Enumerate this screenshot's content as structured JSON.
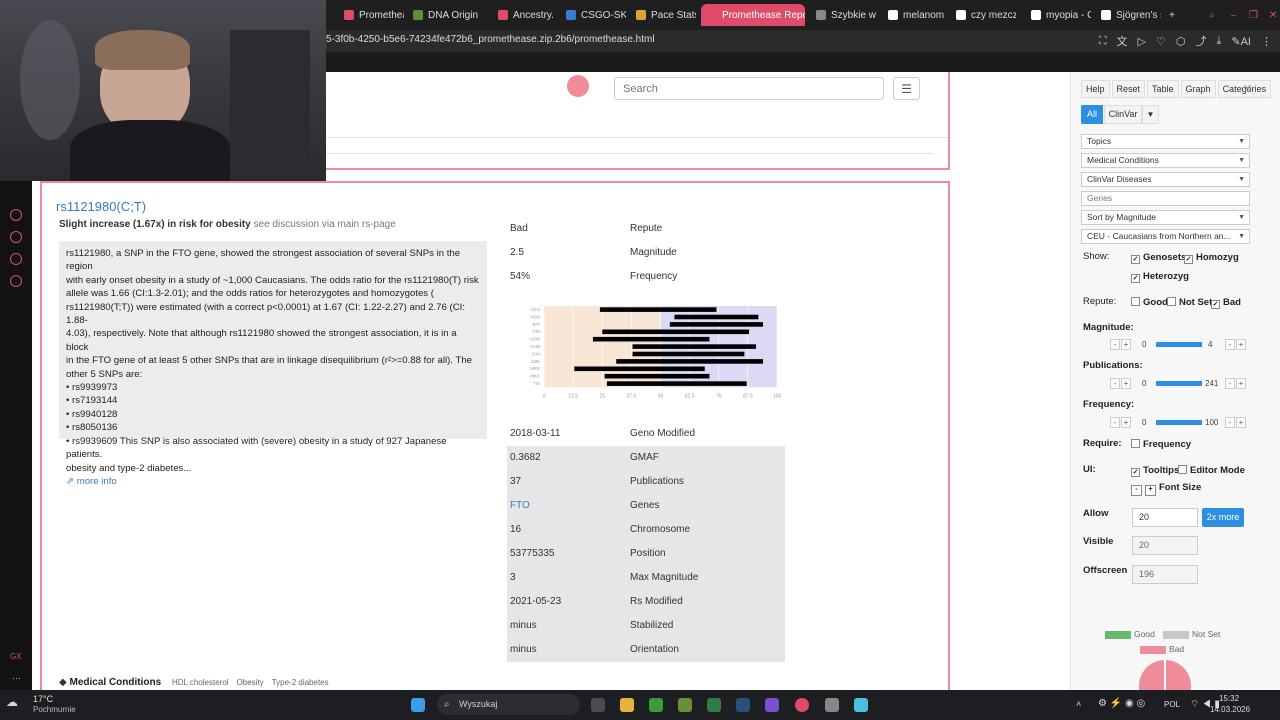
{
  "tabs": [
    {
      "label": "Promethea",
      "color": "#e14b6a",
      "active": false
    },
    {
      "label": "DNA Origin",
      "color": "#5a8f3c",
      "active": false
    },
    {
      "label": "Ancestry.c",
      "color": "#e14b6a",
      "active": false
    },
    {
      "label": "CSGO-SKII",
      "color": "#3a7bd5",
      "active": false
    },
    {
      "label": "Pace Stats",
      "color": "#d9a33a",
      "active": false
    },
    {
      "label": "Promethease Report",
      "color": "#e14b6a",
      "active": true
    },
    {
      "label": "Szybkie wy",
      "color": "#888888",
      "active": false
    },
    {
      "label": "melanoma",
      "color": "#ffffff",
      "active": false
    },
    {
      "label": "czy mezcz",
      "color": "#ffffff",
      "active": false
    },
    {
      "label": "myopia - G",
      "color": "#ffffff",
      "active": false
    },
    {
      "label": "Sjögren's s",
      "color": "#ffffff",
      "active": false
    }
  ],
  "address_url": "5-3f0b-4250-b5e6-74234fe472b6_promethease.zip.2b6/promethease.html",
  "search": {
    "placeholder": "Search"
  },
  "snp": {
    "title": "rs1121980(C;T)",
    "summary_bold": "Slight increase (1.67x) in risk for obesity",
    "summary_grey": "see discussion via main rs-page",
    "desc_lines": [
      "rs1121980, a SNP in the FTO gene, showed the strongest association of several SNPs in the region",
      "with early onset obesity in a study of ~1,000 Caucasians. The odds ratio for the rs1121980(T) risk",
      "allele was 1.66 (CI:1.3-2.01); and the odds ratios for heterozygotes and homozygotes (",
      "rs1121980(T;T)) were estimated (with a correct p<0.0001) at 1.67 (CI: 1.22-2.27) and 2.76 (CI: 1.88-",
      "4.03), respectively. Note that although rs1121980 showed the strongest association, it is in a block",
      "in the FTO gene of at least 5 other SNPs that are in linkage disequilibrium (r²>=0.88 for all). The",
      "other 5 SNPs are:",
      "• rs9939973",
      "• rs7193144",
      "• rs9940128",
      "• rs8050136",
      "• rs9939609 This SNP is also associated with (severe) obesity in a study of 927 Japanese patients.",
      "obesity and type-2 diabetes..."
    ],
    "more_info": "more info",
    "info_top": [
      {
        "value": "Bad",
        "key": "Repute"
      },
      {
        "value": "2.5",
        "key": "Magnitude"
      },
      {
        "value": "54%",
        "key": "Frequency"
      }
    ],
    "info_bottom": [
      {
        "value": "2018-03-11",
        "key": "Geno Modified",
        "link": false
      },
      {
        "value": "0.3682",
        "key": "GMAF",
        "link": false
      },
      {
        "value": "37",
        "key": "Publications",
        "link": false
      },
      {
        "value": "FTO",
        "key": "Genes",
        "link": true
      },
      {
        "value": "16",
        "key": "Chromosome",
        "link": false
      },
      {
        "value": "53775335",
        "key": "Position",
        "link": false
      },
      {
        "value": "3",
        "key": "Max Magnitude",
        "link": false
      },
      {
        "value": "2021-05-23",
        "key": "Rs Modified",
        "link": false
      },
      {
        "value": "minus",
        "key": "Stabilized",
        "link": false
      },
      {
        "value": "minus",
        "key": "Orientation",
        "link": false
      }
    ],
    "medical_conditions_label": "Medical Conditions",
    "medical_conditions": [
      "HDL cholesterol",
      "Obesity",
      "Type-2 diabetes"
    ]
  },
  "chart_data": {
    "type": "bar",
    "title": "",
    "categories": [
      "CEU",
      "HCB",
      "JPT",
      "YRI",
      "ASW",
      "CHD",
      "GIH",
      "LWK",
      "MEX",
      "MKK",
      "TSI"
    ],
    "x": [
      0,
      12.5,
      25,
      37.5,
      50,
      62.5,
      75,
      87.5,
      100
    ],
    "xlim": [
      0,
      100
    ],
    "series": [
      {
        "values_start": [
          24,
          56,
          54,
          25,
          21,
          38,
          38,
          31,
          13,
          26,
          27
        ],
        "values_end": [
          74,
          92,
          94,
          88,
          71,
          91,
          86,
          94,
          69,
          71,
          87
        ]
      }
    ],
    "colors": {
      "bar": "#000000",
      "left_bg": "#f7e6d6",
      "right_bg": "#dcd9f5"
    }
  },
  "right_panel": {
    "buttons": [
      "Help",
      "Reset",
      "Table",
      "Graph",
      "Categories"
    ],
    "all_label": "All",
    "clinvar_label": "ClinVar",
    "selects": [
      "Topics",
      "Medical Conditions",
      "ClinVar Diseases",
      "Genes",
      "Sort by Magnitude",
      "CEU - Caucasians from Northern an..."
    ],
    "show_label": "Show:",
    "show_opts": [
      "Genosets",
      "Homozyg",
      "Heterozyg"
    ],
    "repute_label": "Repute:",
    "repute_opts": [
      "Good",
      "Not Set",
      "Bad"
    ],
    "magnitude_label": "Magnitude:",
    "magnitude": {
      "min": "0",
      "max": "4"
    },
    "publications_label": "Publications:",
    "publications": {
      "min": "0",
      "max": "241"
    },
    "frequency_label": "Frequency:",
    "frequency": {
      "min": "0",
      "max": "100"
    },
    "require_label": "Require:",
    "require_opt": "Frequency",
    "ui_label": "UI:",
    "ui_opts": [
      "Tooltips",
      "Editor Mode"
    ],
    "font_size_label": "Font Size",
    "allow_label": "Allow",
    "allow_value": "20",
    "more_btn": "2x more",
    "visible_label": "Visible",
    "visible_value": "20",
    "offscreen_label": "Offscreen",
    "offscreen_value": "196",
    "legend": [
      {
        "label": "Good",
        "color": "#66bb6a"
      },
      {
        "label": "Not Set",
        "color": "#c8c8c8"
      },
      {
        "label": "Bad",
        "color": "#f08b9a"
      }
    ]
  },
  "taskbar": {
    "weather_temp": "17°C",
    "weather_desc": "Pochmurnie",
    "search_placeholder": "Wyszukaj",
    "lang": "POL",
    "time": "15:32",
    "date": "14.03.2026"
  }
}
